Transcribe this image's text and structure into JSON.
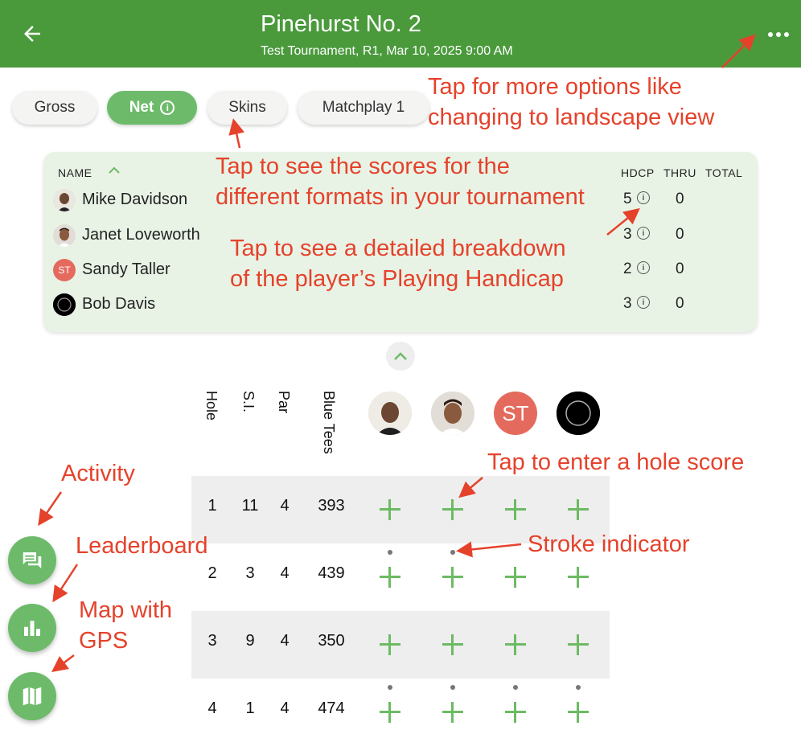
{
  "header": {
    "title": "Pinehurst No. 2",
    "subtitle": "Test Tournament, R1, Mar 10, 2025 9:00 AM",
    "bg_color": "#4a9a3c"
  },
  "tabs": [
    {
      "label": "Gross",
      "active": false
    },
    {
      "label": "Net",
      "active": true,
      "icon": "info-icon"
    },
    {
      "label": "Skins",
      "active": false
    },
    {
      "label": "Matchplay 1",
      "active": false
    }
  ],
  "leaderboard": {
    "col_name": "NAME",
    "col_hdcp": "HDCP",
    "col_thru": "THRU",
    "col_total": "TOTAL",
    "players": [
      {
        "name": "Mike Davidson",
        "hdcp": "5",
        "thru": "0",
        "total": "",
        "avatar": "photo"
      },
      {
        "name": "Janet Loveworth",
        "hdcp": "3",
        "thru": "0",
        "total": "",
        "avatar": "photo"
      },
      {
        "name": "Sandy Taller",
        "hdcp": "2",
        "thru": "0",
        "total": "",
        "avatar": "ST"
      },
      {
        "name": "Bob Davis",
        "hdcp": "3",
        "thru": "0",
        "total": "",
        "avatar": "eclipse"
      }
    ]
  },
  "scorecard": {
    "headers": {
      "hole": "Hole",
      "si": "S.I.",
      "par": "Par",
      "tees": "Blue Tees"
    },
    "player_initials": "ST",
    "holes": [
      {
        "hole": "1",
        "si": "11",
        "par": "4",
        "yards": "393",
        "strokes": [
          0,
          0,
          0,
          0
        ]
      },
      {
        "hole": "2",
        "si": "3",
        "par": "4",
        "yards": "439",
        "strokes": [
          1,
          1,
          0,
          0
        ]
      },
      {
        "hole": "3",
        "si": "9",
        "par": "4",
        "yards": "350",
        "strokes": [
          0,
          0,
          0,
          0
        ]
      },
      {
        "hole": "4",
        "si": "1",
        "par": "4",
        "yards": "474",
        "strokes": [
          1,
          1,
          1,
          1
        ]
      }
    ]
  },
  "annotations": {
    "more_options": "Tap for more options like\nchanging to landscape view",
    "formats": "Tap to see the scores for the\ndifferent formats in your tournament",
    "handicap": "Tap to see a detailed breakdown\nof the player’s Playing Handicap",
    "hole_score": "Tap to enter a hole score",
    "stroke_indicator": "Stroke indicator",
    "activity": "Activity",
    "leaderboard": "Leaderboard",
    "map": "Map with\nGPS",
    "color": "#e5422b"
  },
  "fabs": [
    {
      "name": "activity",
      "icon": "chat-icon"
    },
    {
      "name": "leaderboard",
      "icon": "bar-chart-icon"
    },
    {
      "name": "map",
      "icon": "map-icon"
    }
  ]
}
